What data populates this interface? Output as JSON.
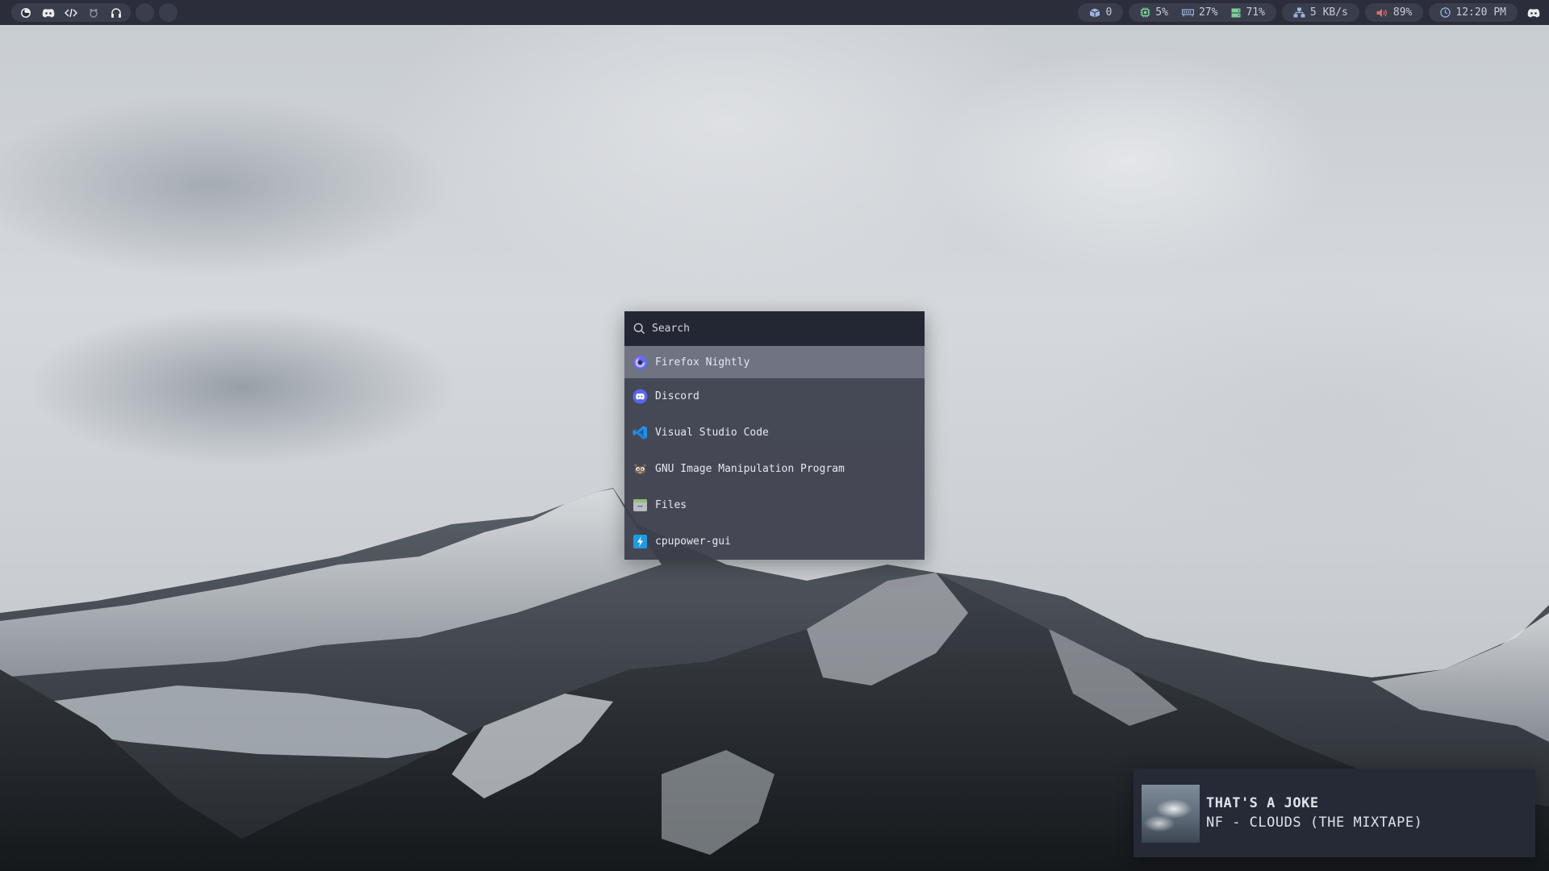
{
  "topbar": {
    "workspaces": [
      {
        "icon": "firefox-icon"
      },
      {
        "icon": "discord-icon"
      },
      {
        "icon": "code-icon"
      },
      {
        "icon": "gimp-icon"
      },
      {
        "icon": "headphones-icon"
      }
    ],
    "empty_workspaces": 2,
    "modules": {
      "updates": {
        "icon": "package-icon",
        "value": "0"
      },
      "cpu": {
        "icon": "cpu-icon",
        "value": "5%"
      },
      "memory": {
        "icon": "memory-icon",
        "value": "27%"
      },
      "disk": {
        "icon": "disk-icon",
        "value": "71%"
      },
      "network": {
        "icon": "network-icon",
        "value": "5 KB/s"
      },
      "volume": {
        "icon": "volume-icon",
        "value": "89%"
      },
      "clock": {
        "icon": "clock-icon",
        "value": "12:20 PM"
      },
      "tray": {
        "icon": "discord-tray-icon"
      }
    },
    "colors": {
      "bar_bg": "#2b2e3a",
      "pill_bg": "#3a3e4c",
      "text": "#c9ccd6",
      "cpu_accent": "#7fcf9a",
      "volume_accent": "#e06c6c"
    }
  },
  "launcher": {
    "search": {
      "placeholder": "Search",
      "value": ""
    },
    "results": [
      {
        "label": "Firefox Nightly",
        "icon": "firefox-nightly-icon",
        "selected": true
      },
      {
        "label": "Discord",
        "icon": "discord-icon",
        "selected": false
      },
      {
        "label": "Visual Studio Code",
        "icon": "vscode-icon",
        "selected": false
      },
      {
        "label": "GNU Image Manipulation Program",
        "icon": "gimp-icon",
        "selected": false
      },
      {
        "label": "Files",
        "icon": "files-icon",
        "selected": false
      },
      {
        "label": "cpupower-gui",
        "icon": "cpupower-gui-icon",
        "selected": false
      }
    ]
  },
  "media": {
    "title": "THAT'S A JOKE",
    "subtitle": "NF - CLOUDS (THE MIXTAPE)",
    "art_icon": "album-art"
  }
}
